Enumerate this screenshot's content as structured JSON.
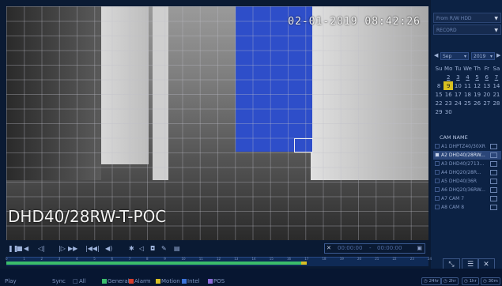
{
  "video": {
    "timestamp": "02-01-2019 08:42:26",
    "channel_name": "DHD40/28RW-T-POC"
  },
  "panel": {
    "source": "From R/W HDD",
    "type": "RECORD",
    "calendar": {
      "month": "Sep",
      "year": "2019",
      "weekdays": [
        "Su",
        "Mo",
        "Tu",
        "We",
        "Th",
        "Fr",
        "Sa"
      ],
      "weeks": [
        [
          "",
          "2",
          "3",
          "4",
          "5",
          "6",
          "7"
        ],
        [
          "8",
          "9",
          "10",
          "11",
          "12",
          "13",
          "14"
        ],
        [
          "15",
          "16",
          "17",
          "18",
          "19",
          "20",
          "21"
        ],
        [
          "22",
          "23",
          "24",
          "25",
          "26",
          "27",
          "28"
        ],
        [
          "29",
          "30",
          "",
          "",
          "",
          "",
          ""
        ]
      ],
      "today": "9"
    },
    "cam_header": "CAM NAME",
    "cameras": [
      {
        "label": "A1 DHPTZ40/30XR",
        "active": false
      },
      {
        "label": "A2 DHD40/28RW...",
        "active": true
      },
      {
        "label": "A3 DHD40/2713...",
        "active": false
      },
      {
        "label": "A4 DHQ20/28R...",
        "active": false
      },
      {
        "label": "A5 DHD40/36R",
        "active": false
      },
      {
        "label": "A6 DHQ20/36RW...",
        "active": false
      },
      {
        "label": "A7 CAM 7",
        "active": false
      },
      {
        "label": "A8 CAM 8",
        "active": false
      }
    ]
  },
  "controls": {
    "time_start": "00:00:00",
    "time_end": "00:00:00"
  },
  "timeline": {
    "ticks": [
      "0",
      "1",
      "2",
      "3",
      "4",
      "5",
      "6",
      "7",
      "8",
      "9",
      "10",
      "11",
      "12",
      "13",
      "14",
      "15",
      "16",
      "17",
      "18",
      "19",
      "20",
      "21",
      "22",
      "23",
      "24"
    ],
    "recorded_until_fraction": 0.698
  },
  "bottom": {
    "play": "Play",
    "sync": "Sync",
    "all": "All",
    "general": "General",
    "alarm": "Alarm",
    "motion": "Motion",
    "intel": "Intel",
    "pos": "POS",
    "zoom_24": "24hr",
    "zoom_2": "2hr",
    "zoom_1": "1hr",
    "zoom_30": "30m"
  },
  "colors": {
    "general": "#3bbd6b",
    "alarm": "#d83c2a",
    "motion": "#d8c024",
    "intel": "#3a72d8",
    "pos": "#8a6ad8"
  }
}
